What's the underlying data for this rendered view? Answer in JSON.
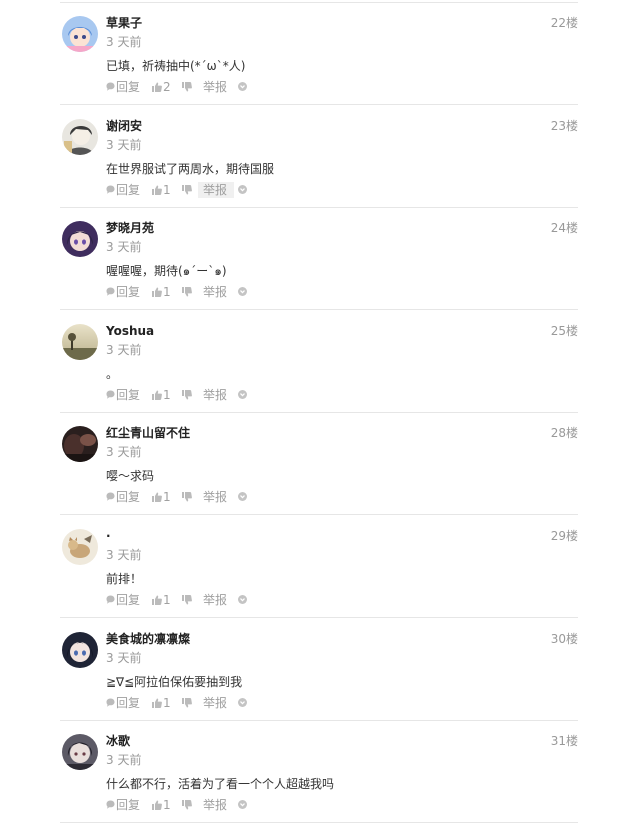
{
  "actions": {
    "reply_label": "回复",
    "report_label": "举报"
  },
  "comments": [
    {
      "user": "草果子",
      "time": "3 天前",
      "floor": "22楼",
      "content": "已填，祈祷抽中(*´ω`*人)",
      "likes": "2",
      "avatar": "anime-girl-blue-avatar"
    },
    {
      "user": "谢闭安",
      "time": "3 天前",
      "floor": "23楼",
      "content": "在世界服试了两周水，期待国服",
      "likes": "1",
      "avatar": "anime-boy-sketch-avatar"
    },
    {
      "user": "梦晓月苑",
      "time": "3 天前",
      "floor": "24楼",
      "content": "喔喔喔，期待(๑´ー`๑)",
      "likes": "1",
      "avatar": "anime-girl-purple-avatar"
    },
    {
      "user": "Yoshua",
      "time": "3 天前",
      "floor": "25楼",
      "content": "。",
      "likes": "1",
      "avatar": "landscape-photo-avatar"
    },
    {
      "user": "红尘青山留不住",
      "time": "3 天前",
      "floor": "28楼",
      "content": "嘤～求码",
      "likes": "1",
      "avatar": "dark-photo-avatar"
    },
    {
      "user": "·",
      "time": "3 天前",
      "floor": "29楼",
      "content": "前排！",
      "likes": "1",
      "avatar": "cat-sketch-avatar"
    },
    {
      "user": "美食城的凛凛燦",
      "time": "3 天前",
      "floor": "30楼",
      "content": "≧∇≦阿拉伯保佑要抽到我",
      "likes": "1",
      "avatar": "anime-girl-dark-avatar"
    },
    {
      "user": "冰歌",
      "time": "3 天前",
      "floor": "31楼",
      "content": "什么都不行，活着为了看一个个人超越我吗",
      "likes": "1",
      "avatar": "anime-boy-dark-avatar"
    }
  ]
}
